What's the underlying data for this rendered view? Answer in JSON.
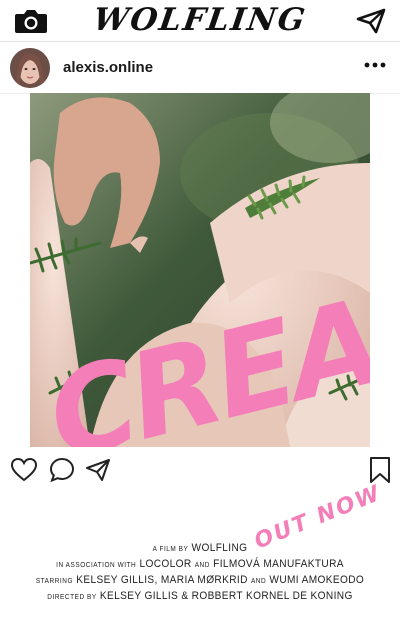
{
  "app": {
    "title": "WOLFLING",
    "camera_icon": "camera-icon",
    "send_icon": "paper-plane-icon"
  },
  "post": {
    "username": "alexis.online",
    "avatar_icon": "avatar",
    "more_icon": "more-dots-icon",
    "image": {
      "title_text": "CREAM",
      "accent_color": "#f47fb8"
    },
    "actions": {
      "like_icon": "heart-icon",
      "comment_icon": "comment-icon",
      "share_icon": "paper-plane-icon",
      "save_icon": "bookmark-icon"
    },
    "tagline": "OUT NOW",
    "credits": {
      "line1_small": "A FILM BY",
      "line1_main": "WOLFLING",
      "line2_small": "IN ASSOCIATION WITH",
      "line2_a": "LOCOLOR",
      "line2_and": "AND",
      "line2_b": "FILMOVÁ MANUFAKTURA",
      "line3_small": "STARRING",
      "line3_a": "KELSEY GILLIS, MARIA MØRKRID",
      "line3_and": "AND",
      "line3_b": "WUMI AMOKEODO",
      "line4_small": "DIRECTED BY",
      "line4_a": "KELSEY GILLIS & ROBBERT KORNEL DE KONING"
    }
  }
}
